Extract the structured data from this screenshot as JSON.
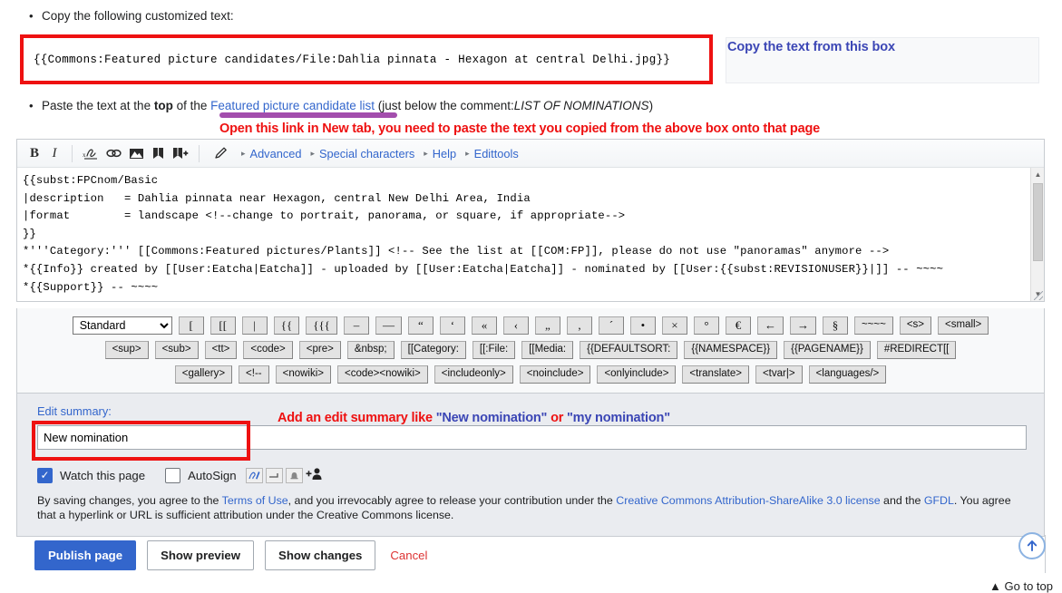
{
  "instructions": {
    "step1": "Copy the following customized text:",
    "step2_prefix": "Paste the text at the ",
    "step2_bold": "top",
    "step2_mid": " of the ",
    "step2_link": "Featured picture candidate list",
    "step2_paren_a": " (just below the comment:",
    "step2_italic": "LIST OF NOMINATIONS",
    "step2_paren_b": ")"
  },
  "copy_box": {
    "snippet": "{{Commons:Featured picture candidates/File:Dahlia pinnata - Hexagon at central Delhi.jpg}}",
    "callout": "Copy the text from this box"
  },
  "annotations": {
    "open_link": "Open this link in New tab, you need to paste the text you copied from the above box onto that page",
    "summary_part1": "Add an edit summary like ",
    "summary_blue1": "\"New nomination\"",
    "summary_part2": " or ",
    "summary_blue2": "\"my nomination\"",
    "accent_red": "#ee1111",
    "accent_blue": "#3b46b5",
    "accent_purple": "#a34ead"
  },
  "toolbar": {
    "bold": "B",
    "italic": "I",
    "icons": [
      {
        "name": "signature-icon",
        "glyph": "✐"
      },
      {
        "name": "link-icon",
        "glyph": "⚭"
      },
      {
        "name": "image-icon",
        "glyph": "⛰"
      },
      {
        "name": "reference-icon",
        "glyph": "▮"
      },
      {
        "name": "insert-reference-icon",
        "glyph": "▮"
      }
    ],
    "pencil": "✎",
    "menus": [
      {
        "label": "Advanced"
      },
      {
        "label": "Special characters"
      },
      {
        "label": "Help"
      },
      {
        "label": "Edittools"
      }
    ],
    "caret": "▸"
  },
  "wikitext": {
    "content": "{{subst:FPCnom/Basic\n|description   = Dahlia pinnata near Hexagon, central New Delhi Area, India\n|format        = landscape <!--change to portrait, panorama, or square, if appropriate-->\n}}\n*'''Category:''' [[Commons:Featured pictures/Plants]] <!-- See the list at [[COM:FP]], please do not use \"panoramas\" anymore -->\n*{{Info}} created by [[User:Eatcha|Eatcha]] - uploaded by [[User:Eatcha|Eatcha]] - nominated by [[User:{{subst:REVISIONUSER}}|]] -- ~~~~\n*{{Support}} -- ~~~~\n+"
  },
  "edittools": {
    "selected_set": "Standard",
    "row1": [
      "[",
      "[[",
      "|",
      "{{",
      "{{{",
      "–",
      "—",
      "“",
      "‘",
      "«",
      "‹",
      "„",
      "‚",
      "´",
      "•",
      "×",
      "°",
      "€",
      "←",
      "→",
      "§",
      "~~~~",
      "<s>",
      "<small>"
    ],
    "row2": [
      "<sup>",
      "<sub>",
      "<tt>",
      "<code>",
      "<pre>",
      "&nbsp;",
      "[[Category:",
      "[[:File:",
      "[[Media:",
      "{{DEFAULTSORT:",
      "{{NAMESPACE}}",
      "{{PAGENAME}}",
      "#REDIRECT[["
    ],
    "row3": [
      "<gallery>",
      "<!--",
      "<nowiki>",
      "<code><nowiki>",
      "<includeonly>",
      "<noinclude>",
      "<onlyinclude>",
      "<translate>",
      "<tvar|>",
      "<languages/>"
    ]
  },
  "summary": {
    "label": "Edit summary:",
    "value": "New nomination",
    "watch_label": "Watch this page",
    "watch_checked": true,
    "autosign_label": "AutoSign",
    "autosign_checked": false,
    "legal_a": "By saving changes, you agree to the ",
    "legal_link1": "Terms of Use",
    "legal_b": ", and you irrevocably agree to release your contribution under the ",
    "legal_link2": "Creative Commons Attribution-ShareAlike 3.0 license",
    "legal_c": " and the ",
    "legal_link3": "GFDL",
    "legal_d": ". You agree that a hyperlink or URL is sufficient attribution under the Creative Commons license."
  },
  "buttons": {
    "publish": "Publish page",
    "preview": "Show preview",
    "changes": "Show changes",
    "cancel": "Cancel"
  },
  "footer": {
    "go_to_top": "▲ Go to top",
    "up_arrow": "⬆"
  }
}
